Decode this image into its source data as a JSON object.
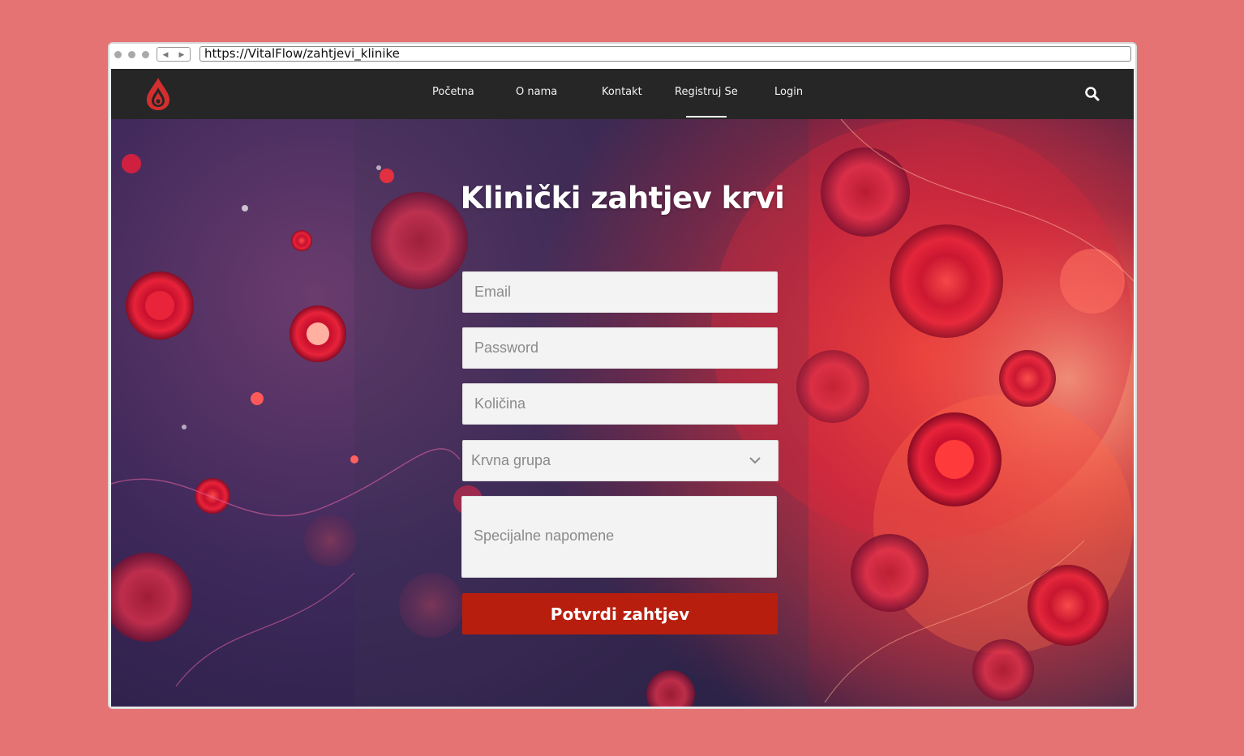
{
  "browser": {
    "url": "https://VitalFlow/zahtjevi_klinike",
    "back_glyph": "◀",
    "forward_glyph": "▶"
  },
  "nav": {
    "logo_icon": "blood-drop-icon",
    "items": [
      {
        "label": "Početna"
      },
      {
        "label": "O nama"
      },
      {
        "label": "Kontakt"
      },
      {
        "label": "Registruj Se"
      },
      {
        "label": "Login"
      }
    ],
    "active_index": 3,
    "search_icon": "search-icon"
  },
  "form": {
    "title": "Klinički zahtjev krvi",
    "email_placeholder": "Email",
    "password_placeholder": "Password",
    "quantity_placeholder": "Količina",
    "blood_type_placeholder": "Krvna grupa",
    "notes_placeholder": "Specijalne napomene",
    "submit_label": "Potvrdi zahtjev"
  },
  "colors": {
    "page_background": "#e57373",
    "navbar": "#262626",
    "submit_button": "#b81e0d",
    "logo_red": "#d32f2f"
  }
}
